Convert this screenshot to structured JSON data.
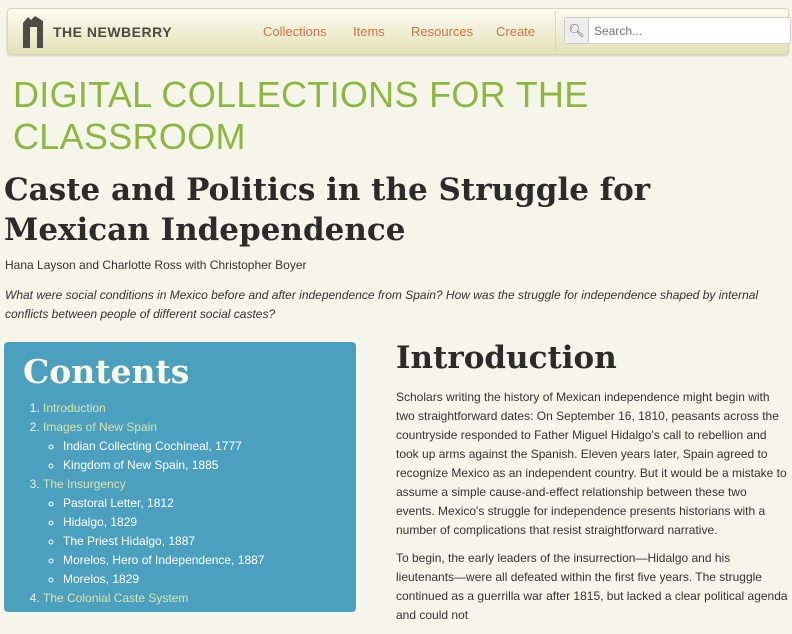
{
  "nav": {
    "logo": "THE NEWBERRY",
    "links": [
      "Collections",
      "Items",
      "Resources",
      "Create"
    ],
    "search_placeholder": "Search..."
  },
  "site_title": "DIGITAL COLLECTIONS FOR THE CLASSROOM",
  "page": {
    "title": "Caste and Politics in the Struggle for Mexican Independence",
    "authors": "Hana Layson and Charlotte Ross with Christopher Boyer",
    "question": "What were social conditions in Mexico before and after independence from Spain? How was the struggle for independence shaped by internal conflicts between people of different social castes?"
  },
  "contents": {
    "heading": "Contents",
    "items": [
      {
        "label": "Introduction",
        "sub": []
      },
      {
        "label": "Images of New Spain",
        "sub": [
          "Indian Collecting Cochineal, 1777",
          "Kingdom of New Spain, 1885"
        ]
      },
      {
        "label": "The Insurgency",
        "sub": [
          "Pastoral Letter, 1812",
          "Hidalgo, 1829",
          "The Priest Hidalgo, 1887",
          "Morelos, Hero of Independence, 1887",
          "Morelos, 1829"
        ]
      },
      {
        "label": "The Colonial Caste System",
        "sub": []
      }
    ]
  },
  "intro": {
    "heading": "Introduction",
    "paragraphs": [
      "Scholars writing the history of Mexican independence might begin with two straightforward dates: On September 16, 1810, peasants across the countryside responded to Father Miguel Hidalgo's call to rebellion and took up arms against the Spanish. Eleven years later, Spain agreed to recognize Mexico as an independent country. But it would be a mistake to assume a simple cause-and-effect relationship between these two events. Mexico's struggle for independence presents historians with a number of complications that resist straightforward narrative.",
      "To begin, the early leaders of the insurrection—Hidalgo and his lieutenants—were all defeated within the first five years. The struggle continued as a guerrilla war after 1815, but lacked a clear political agenda and could not"
    ]
  }
}
